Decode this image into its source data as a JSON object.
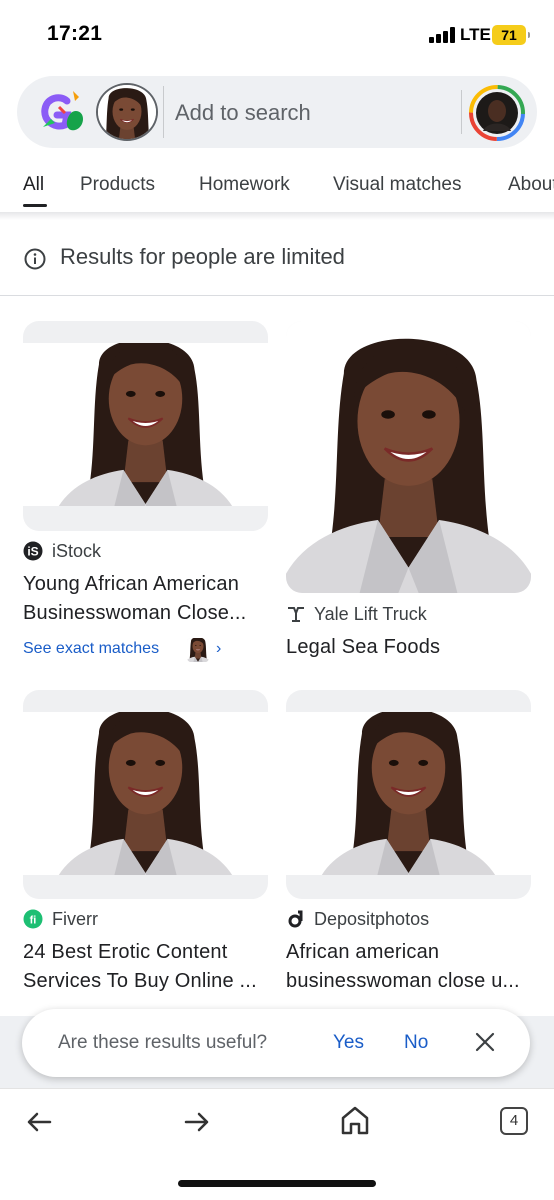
{
  "status_bar": {
    "time": "17:21",
    "network": "LTE",
    "battery": "71"
  },
  "search": {
    "placeholder": "Add to search",
    "lens_logo_icon": "google-lens-icon",
    "account_icon": "account-avatar"
  },
  "tabs": [
    {
      "label": "All",
      "active": true
    },
    {
      "label": "Products",
      "active": false
    },
    {
      "label": "Homework",
      "active": false
    },
    {
      "label": "Visual matches",
      "active": false
    },
    {
      "label": "About",
      "active": false
    }
  ],
  "notice": {
    "icon": "info-icon",
    "text": "Results for people are limited"
  },
  "results": [
    {
      "source": "iStock",
      "source_icon": "istock-icon",
      "title_line1": "Young African American",
      "title_line2": "Businesswoman Close...",
      "link": "See exact matches",
      "link_chevron": "›"
    },
    {
      "source": "Yale Lift Truck",
      "source_icon": "yale-logo-icon",
      "title_line1": "Legal Sea Foods"
    },
    {
      "source": "Fiverr",
      "source_icon": "fiverr-icon",
      "title_line1": "24 Best Erotic Content",
      "title_line2": "Services To Buy Online ..."
    },
    {
      "source": "Depositphotos",
      "source_icon": "depositphotos-icon",
      "title_line1": "African american",
      "title_line2": "businesswoman close u..."
    }
  ],
  "feedback": {
    "question": "Are these results useful?",
    "yes": "Yes",
    "no": "No"
  },
  "bottom_nav": {
    "tab_count": "4"
  },
  "colors": {
    "link": "#1a5dc8",
    "card_bg": "#eff0f2",
    "battery": "#f5cc1a"
  }
}
